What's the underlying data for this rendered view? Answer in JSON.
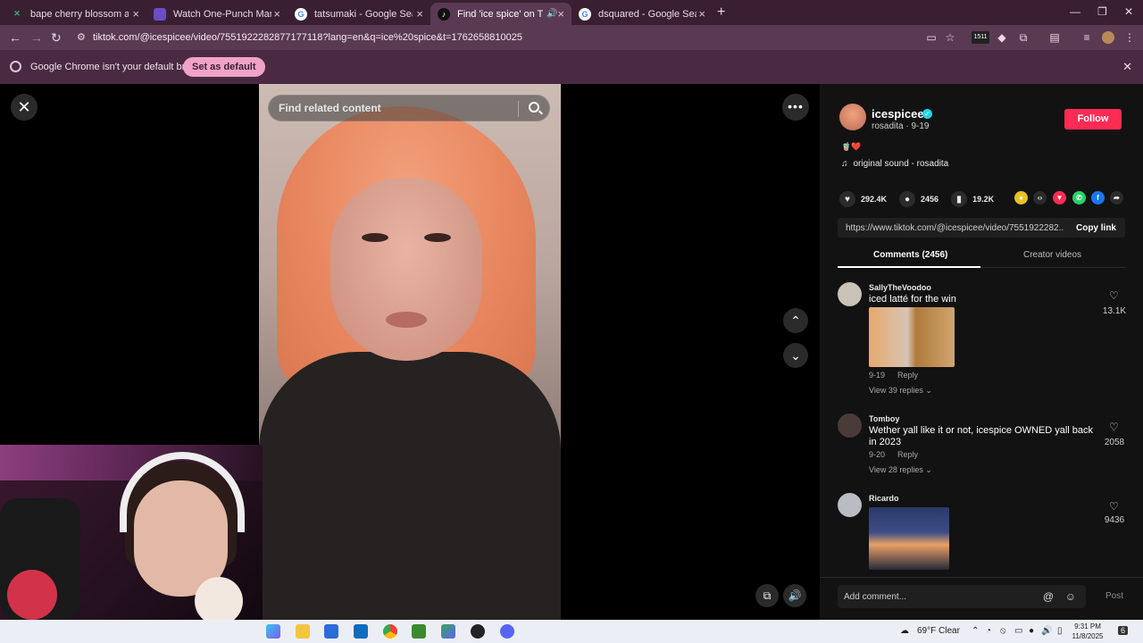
{
  "browser": {
    "tabs": [
      {
        "title": "bape cherry blossom at StockX",
        "favicon_color": "#0a6b3b",
        "active": false
      },
      {
        "title": "Watch One-Punch Man full HD",
        "favicon_color": "#6a4dc4",
        "active": false
      },
      {
        "title": "tatsumaki - Google Search",
        "favicon_color": "#ffffff",
        "active": false
      },
      {
        "title": "Find 'ice spice' on TikTok | T",
        "favicon_color": "#111111",
        "active": true
      },
      {
        "title": "dsquared - Google Search",
        "favicon_color": "#ffffff",
        "active": false
      }
    ],
    "url": "tiktok.com/@icespicee/video/7551922282877177118?lang=en&q=ice%20spice&t=1762658810025",
    "extension_badge": "1511",
    "infobar": {
      "message": "Google Chrome isn't your default browser",
      "button": "Set as default"
    }
  },
  "video": {
    "search_placeholder": "Find related content"
  },
  "panel": {
    "username": "icespicee",
    "subline": "rosadita · 9-19",
    "follow_label": "Follow",
    "sound": "original sound - rosadita",
    "stats": {
      "likes": "292.4K",
      "comments": "2456",
      "saves": "19.2K"
    },
    "link": "https://www.tiktok.com/@icespicee/video/7551922282...",
    "copy_label": "Copy link",
    "tabs": {
      "comments": "Comments (2456)",
      "creator": "Creator videos"
    },
    "comments": [
      {
        "name": "SallyTheVoodoo",
        "text": "iced latté for the win",
        "date": "9-19",
        "reply": "Reply",
        "views": "View 39 replies",
        "likes": "13.1K"
      },
      {
        "name": "Tomboy",
        "text": "Wether yall like it or not, icespice OWNED yall back in 2023",
        "date": "9-20",
        "reply": "Reply",
        "views": "View 28 replies",
        "likes": "2058"
      },
      {
        "name": "Ricardo",
        "text": "",
        "likes": "9436"
      }
    ],
    "add_placeholder": "Add comment...",
    "post_label": "Post"
  },
  "taskbar": {
    "weather": "69°F  Clear",
    "time": "9:31 PM",
    "date": "11/8/2025",
    "notification_count": "6"
  }
}
